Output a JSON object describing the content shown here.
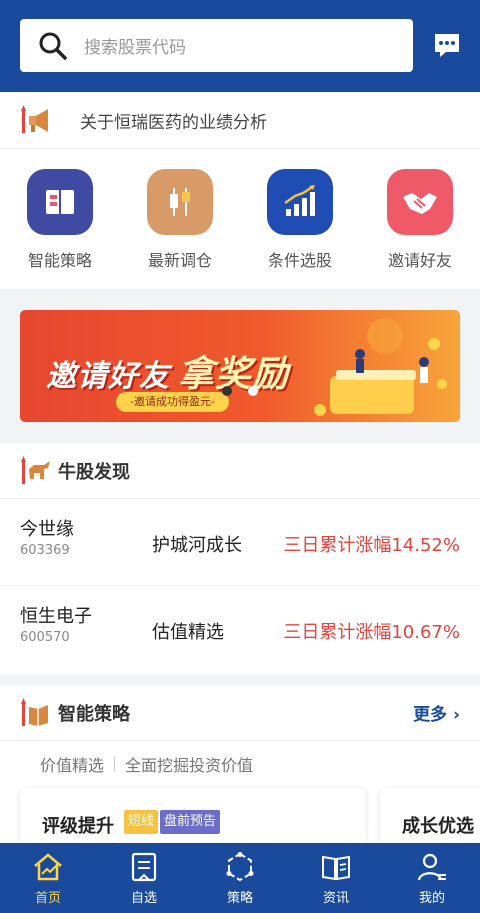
{
  "search": {
    "placeholder": "搜索股票代码"
  },
  "news": {
    "text": "关于恒瑞医药的业绩分析"
  },
  "quick_menu": [
    {
      "label": "智能策略",
      "icon": "book-icon",
      "color": "#3f4aa3"
    },
    {
      "label": "最新调仓",
      "icon": "candlestick-icon",
      "color": "#d89a67"
    },
    {
      "label": "条件选股",
      "icon": "bar-chart-icon",
      "color": "#1f4db4"
    },
    {
      "label": "邀请好友",
      "icon": "handshake-icon",
      "color": "#f05a68"
    }
  ],
  "banner": {
    "title": "邀请好友",
    "title_big": "拿奖励",
    "subtitle": "-邀请成功得盈元-"
  },
  "bull": {
    "title": "牛股发现",
    "rows": [
      {
        "name": "今世缘",
        "code": "603369",
        "tag": "护城河成长",
        "rise": "三日累计涨幅14.52%"
      },
      {
        "name": "恒生电子",
        "code": "600570",
        "tag": "估值精选",
        "rise": "三日累计涨幅10.67%"
      }
    ]
  },
  "strategy": {
    "title": "智能策略",
    "more": "更多",
    "sub_a": "价值精选",
    "sub_b": "全面挖掘投资价值",
    "card1": {
      "title": "评级提升",
      "badge1": "短线",
      "badge2": "盘前预告"
    },
    "card2": {
      "title": "成长优选"
    }
  },
  "nav": [
    {
      "label": "首页",
      "icon": "home-icon",
      "active": true
    },
    {
      "label": "自选",
      "icon": "watchlist-icon"
    },
    {
      "label": "策略",
      "icon": "strategy-icon"
    },
    {
      "label": "资讯",
      "icon": "news-icon"
    },
    {
      "label": "我的",
      "icon": "profile-icon"
    }
  ],
  "colors": {
    "primary": "#1a4a9c",
    "rise": "#e0453f",
    "active_nav": "#ffd54a"
  }
}
